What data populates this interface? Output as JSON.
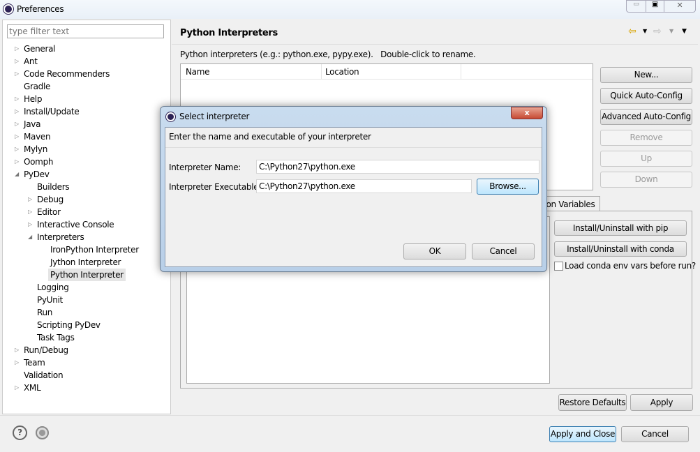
{
  "window": {
    "title": "Preferences"
  },
  "filter": {
    "placeholder": "type filter text"
  },
  "tree": [
    {
      "label": "General",
      "level": 0,
      "arrow": "right"
    },
    {
      "label": "Ant",
      "level": 0,
      "arrow": "right"
    },
    {
      "label": "Code Recommenders",
      "level": 0,
      "arrow": "right"
    },
    {
      "label": "Gradle",
      "level": 0,
      "arrow": ""
    },
    {
      "label": "Help",
      "level": 0,
      "arrow": "right"
    },
    {
      "label": "Install/Update",
      "level": 0,
      "arrow": "right"
    },
    {
      "label": "Java",
      "level": 0,
      "arrow": "right"
    },
    {
      "label": "Maven",
      "level": 0,
      "arrow": "right"
    },
    {
      "label": "Mylyn",
      "level": 0,
      "arrow": "right"
    },
    {
      "label": "Oomph",
      "level": 0,
      "arrow": "right"
    },
    {
      "label": "PyDev",
      "level": 0,
      "arrow": "down"
    },
    {
      "label": "Builders",
      "level": 1,
      "arrow": ""
    },
    {
      "label": "Debug",
      "level": 1,
      "arrow": "right"
    },
    {
      "label": "Editor",
      "level": 1,
      "arrow": "right"
    },
    {
      "label": "Interactive Console",
      "level": 1,
      "arrow": "right"
    },
    {
      "label": "Interpreters",
      "level": 1,
      "arrow": "down"
    },
    {
      "label": "IronPython Interpreter",
      "level": 2,
      "arrow": ""
    },
    {
      "label": "Jython Interpreter",
      "level": 2,
      "arrow": ""
    },
    {
      "label": "Python Interpreter",
      "level": 2,
      "arrow": "",
      "selected": true
    },
    {
      "label": "Logging",
      "level": 1,
      "arrow": ""
    },
    {
      "label": "PyUnit",
      "level": 1,
      "arrow": ""
    },
    {
      "label": "Run",
      "level": 1,
      "arrow": ""
    },
    {
      "label": "Scripting PyDev",
      "level": 1,
      "arrow": ""
    },
    {
      "label": "Task Tags",
      "level": 1,
      "arrow": ""
    },
    {
      "label": "Run/Debug",
      "level": 0,
      "arrow": "right"
    },
    {
      "label": "Team",
      "level": 0,
      "arrow": "right"
    },
    {
      "label": "Validation",
      "level": 0,
      "arrow": ""
    },
    {
      "label": "XML",
      "level": 0,
      "arrow": "right"
    }
  ],
  "page": {
    "title": "Python Interpreters",
    "description": "Python interpreters (e.g.: python.exe, pypy.exe).   Double-click to rename.",
    "columns": [
      "Name",
      "Location"
    ],
    "buttons": {
      "new": "New...",
      "quick": "Quick Auto-Config",
      "advanced": "Advanced Auto-Config",
      "remove": "Remove",
      "up": "Up",
      "down": "Down"
    },
    "tab_partial": "tion Variables",
    "pip": "Install/Uninstall with pip",
    "conda": "Install/Uninstall with conda",
    "conda_check": "Load conda env vars before run?",
    "restore": "Restore Defaults",
    "apply": "Apply"
  },
  "footer": {
    "apply_close": "Apply and Close",
    "cancel": "Cancel"
  },
  "dialog": {
    "title": "Select interpreter",
    "message": "Enter the name and executable of your interpreter",
    "name_label": "Interpreter Name:",
    "name_value": "C:\\Python27\\python.exe",
    "exe_label": "Interpreter Executable:",
    "exe_value": "C:\\Python27\\python.exe",
    "browse": "Browse...",
    "ok": "OK",
    "cancel": "Cancel"
  }
}
